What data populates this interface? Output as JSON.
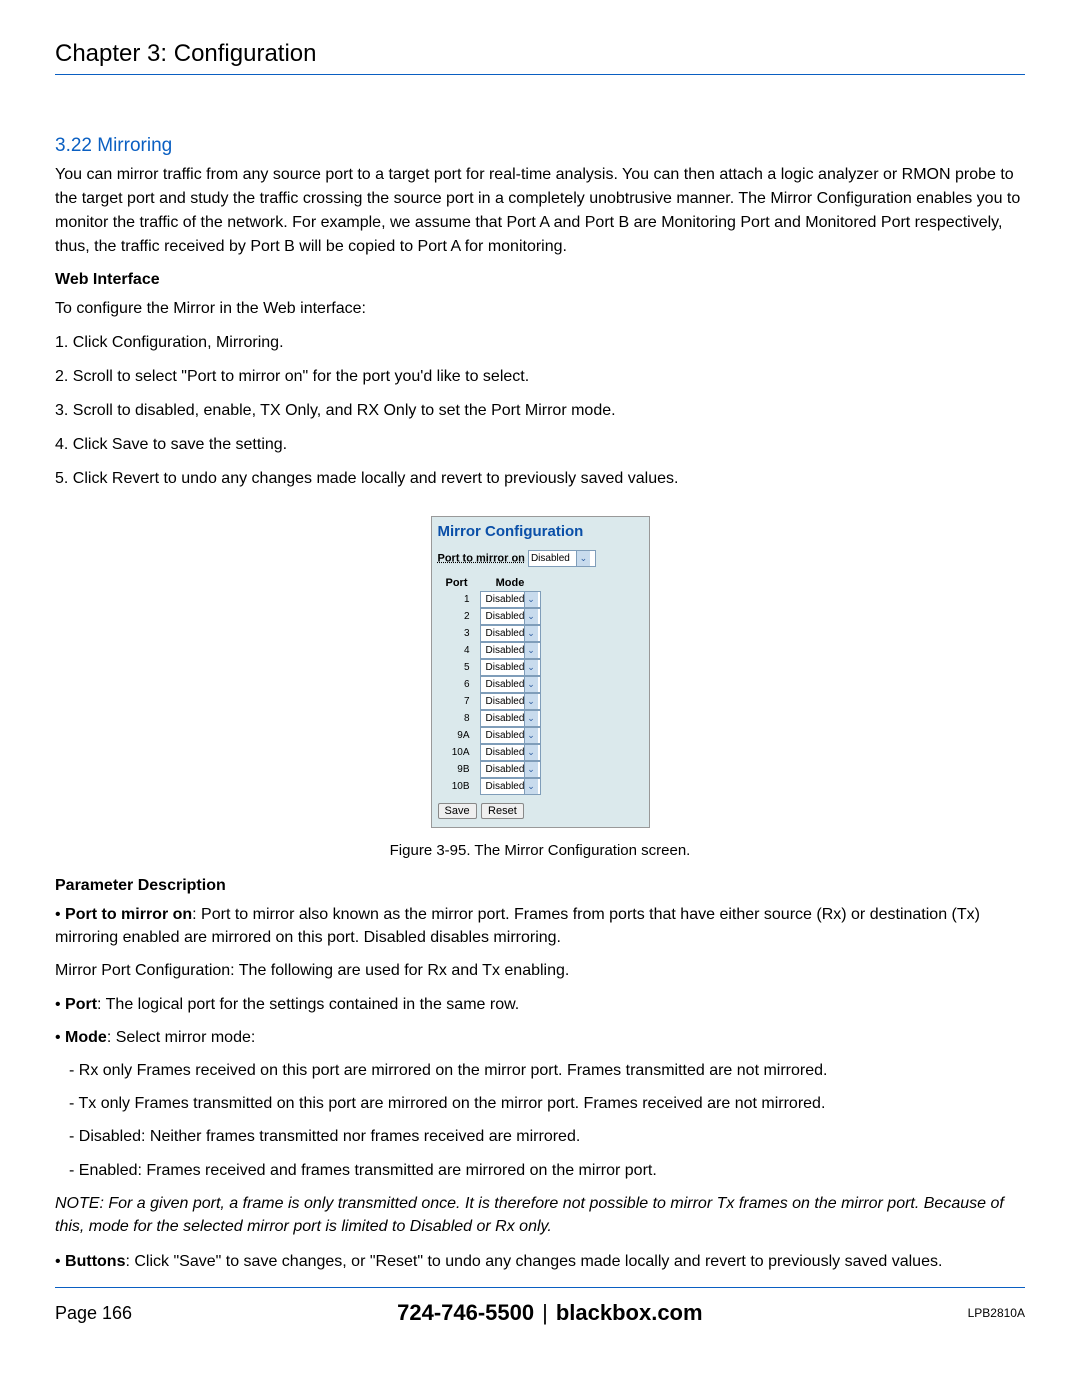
{
  "chapter_title": "Chapter 3: Configuration",
  "section": {
    "number_title": "3.22 Mirroring",
    "intro": "You can mirror traffic from any source port to a target port for real-time analysis. You can then attach a logic analyzer or RMON probe to the target port and study the traffic crossing the source port in a completely unobtrusive manner. The Mirror Configuration enables you to monitor the traffic of the network. For example, we assume that Port A and Port B are Monitoring Port and Monitored Port respectively, thus, the traffic received by Port B will be copied to Port A for monitoring."
  },
  "web_interface": {
    "heading": "Web Interface",
    "lead": "To configure the Mirror in the Web interface:",
    "steps": [
      "1. Click Configuration, Mirroring.",
      "2. Scroll to select \"Port to mirror on\" for the port you'd like to select.",
      "3. Scroll to disabled, enable, TX Only, and RX Only to set the Port Mirror mode.",
      "4. Click Save to save the setting.",
      "5. Click Revert to undo any changes made locally and revert to previously saved values."
    ]
  },
  "mirror_config": {
    "title": "Mirror Configuration",
    "port_to_mirror_label": "Port to mirror on",
    "port_to_mirror_value": "Disabled",
    "col_port": "Port",
    "col_mode": "Mode",
    "rows": [
      {
        "port": "1",
        "mode": "Disabled"
      },
      {
        "port": "2",
        "mode": "Disabled"
      },
      {
        "port": "3",
        "mode": "Disabled"
      },
      {
        "port": "4",
        "mode": "Disabled"
      },
      {
        "port": "5",
        "mode": "Disabled"
      },
      {
        "port": "6",
        "mode": "Disabled"
      },
      {
        "port": "7",
        "mode": "Disabled"
      },
      {
        "port": "8",
        "mode": "Disabled"
      },
      {
        "port": "9A",
        "mode": "Disabled"
      },
      {
        "port": "10A",
        "mode": "Disabled"
      },
      {
        "port": "9B",
        "mode": "Disabled"
      },
      {
        "port": "10B",
        "mode": "Disabled"
      }
    ],
    "btn_save": "Save",
    "btn_reset": "Reset"
  },
  "figure_caption": "Figure 3-95. The Mirror Configuration screen.",
  "params": {
    "heading": "Parameter Description",
    "port_mirror_label": "Port to mirror on",
    "port_mirror_text": ": Port to mirror also known as the mirror port. Frames from ports that have either source (Rx) or destination (Tx) mirroring enabled are mirrored on this port. Disabled disables mirroring.",
    "mirror_port_cfg": "Mirror Port Configuration: The following are used for Rx and Tx enabling.",
    "port_label": "Port",
    "port_text": ": The logical port for the settings contained in the same row.",
    "mode_label": "Mode",
    "mode_text": ": Select mirror mode:",
    "mode_rx": "- Rx only Frames received on this port are mirrored on the mirror port. Frames transmitted are not mirrored.",
    "mode_tx": "- Tx only Frames transmitted on this port are mirrored on the mirror port. Frames received are not mirrored.",
    "mode_disabled": "- Disabled: Neither frames transmitted nor frames received are mirrored.",
    "mode_enabled": "- Enabled: Frames received and frames transmitted are mirrored on the mirror port.",
    "note": "NOTE: For a given port, a frame is only transmitted once. It is therefore not possible to mirror Tx frames on the mirror port. Because of this, mode for the selected mirror port is limited to Disabled or Rx only.",
    "buttons_label": "Buttons",
    "buttons_text": ": Click \"Save\" to save changes, or \"Reset\" to undo any changes made locally and revert to previously saved values."
  },
  "footer": {
    "page": "Page 166",
    "phone": "724-746-5500",
    "site": "blackbox.com",
    "model": "LPB2810A"
  }
}
